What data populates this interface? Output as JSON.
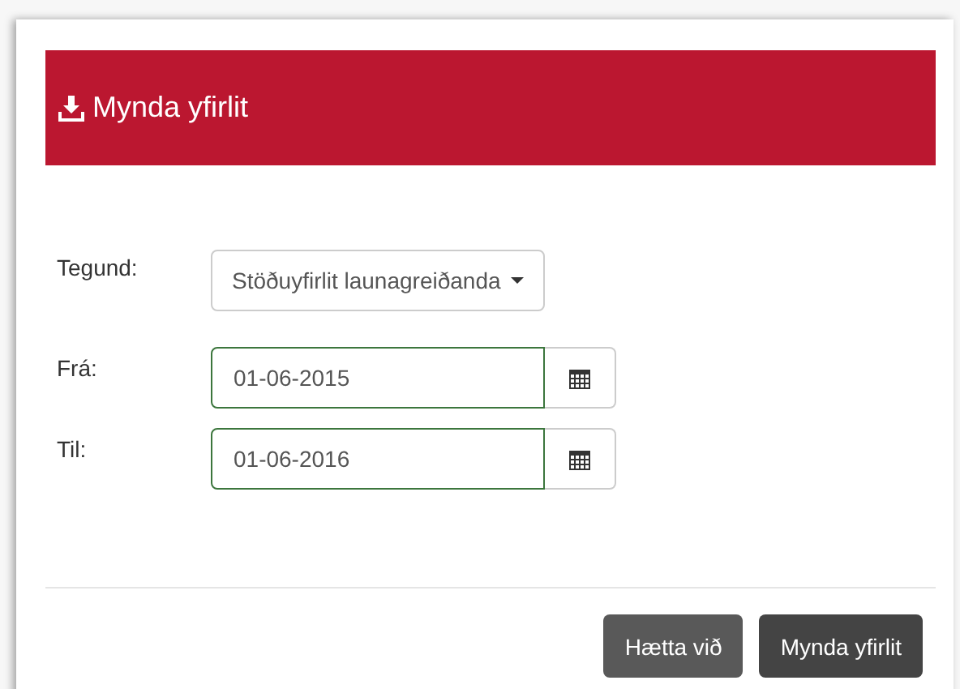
{
  "header": {
    "title": "Mynda yfirlit"
  },
  "fields": [
    {
      "kind": "select",
      "label": "Tegund:",
      "value": "Stöðuyfirlit launagreiðanda"
    },
    {
      "kind": "date",
      "label": "Frá:",
      "value": "01-06-2015"
    },
    {
      "kind": "date",
      "label": "Til:",
      "value": "01-06-2016"
    }
  ],
  "buttons": [
    {
      "label": "Hætta við",
      "kind": "secondary"
    },
    {
      "label": "Mynda yfirlit",
      "kind": "primary"
    }
  ]
}
